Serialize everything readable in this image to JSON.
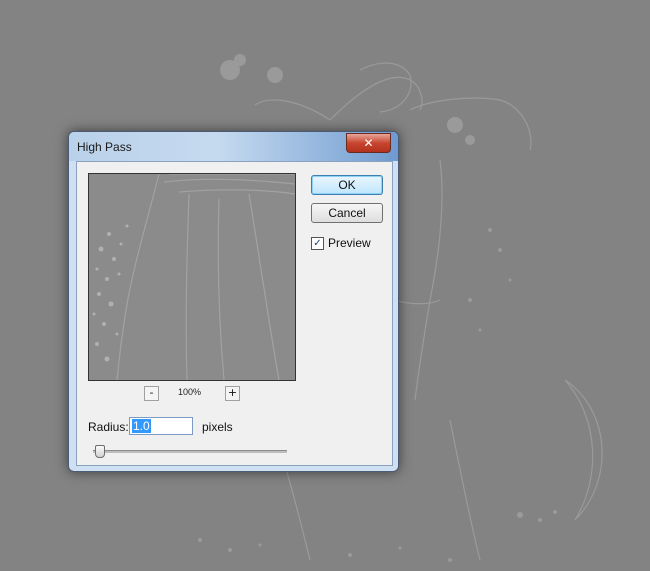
{
  "dialog": {
    "title": "High Pass",
    "close_glyph": "✕",
    "buttons": {
      "ok": "OK",
      "cancel": "Cancel"
    },
    "preview_checkbox": {
      "label": "Preview",
      "checked": true
    },
    "zoom": {
      "minus": "-",
      "plus": "+",
      "level": "100%"
    },
    "radius": {
      "label": "Radius:",
      "value": "1.0",
      "units": "pixels",
      "slider_fraction": 0.03
    }
  },
  "icons": {
    "close": "close-icon",
    "checkmark": "checkmark-icon"
  },
  "colors": {
    "background": "#838383",
    "titlebar": "#c6daef",
    "close_button": "#c8452f",
    "selection": "#3399ff"
  }
}
